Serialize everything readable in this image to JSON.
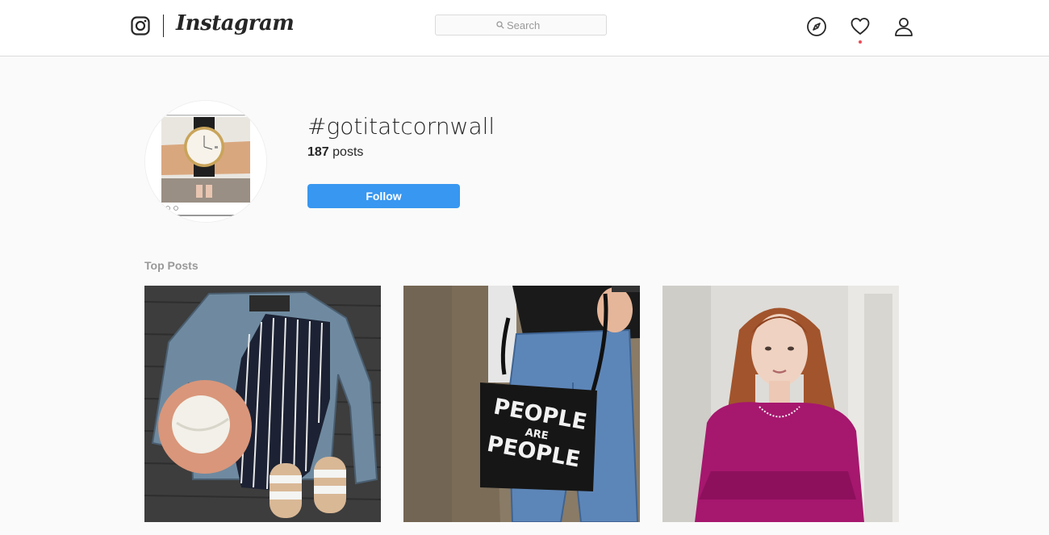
{
  "nav": {
    "logo_text": "Instagram",
    "search_placeholder": "Search",
    "icons": [
      "camera-icon",
      "compass-icon",
      "heart-icon",
      "user-icon"
    ],
    "notification_dot_color": "#ed4956"
  },
  "header": {
    "hashtag": "#gotitatcornwall",
    "posts_count": "187",
    "posts_label": " posts",
    "follow_label": "Follow",
    "follow_color": "#3897f0"
  },
  "top_posts": {
    "title": "Top Posts",
    "items": [
      {
        "description_icon": "outfit-flatlay-photo"
      },
      {
        "description_icon": "handbag-photo",
        "bag_text_1": "PEOPLE",
        "bag_text_2": "ARE",
        "bag_text_3": "PEOPLE"
      },
      {
        "description_icon": "portrait-photo"
      }
    ]
  }
}
